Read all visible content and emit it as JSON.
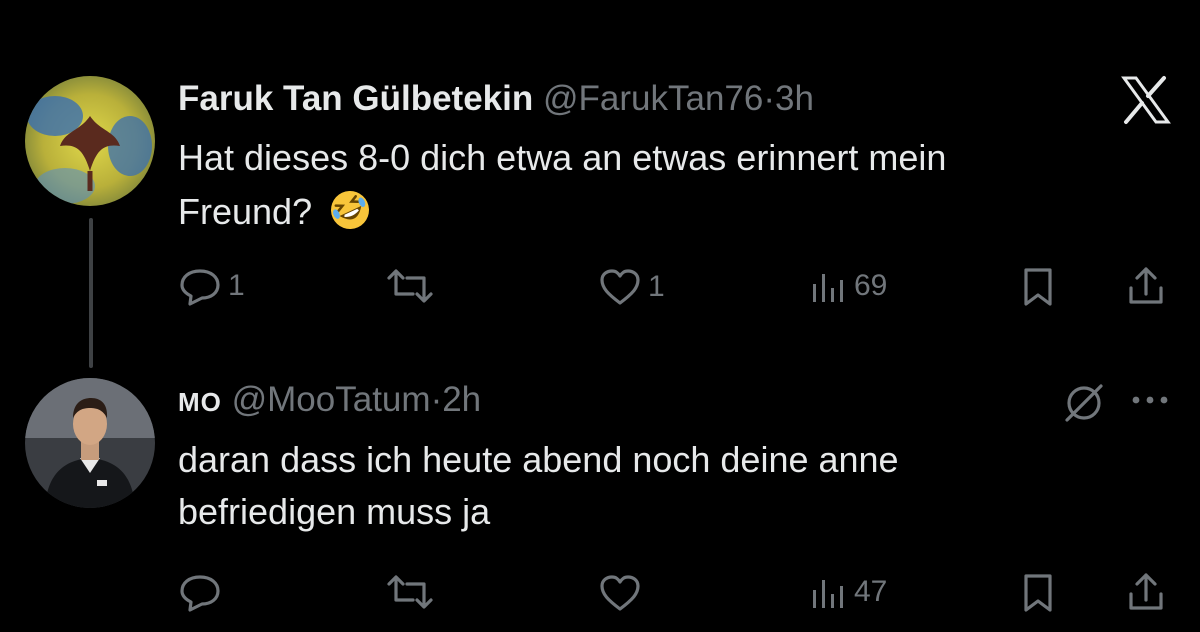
{
  "tweets": [
    {
      "name": "Faruk Tan Gülbetekin",
      "handle": "@FarukTan76",
      "separator": "·",
      "time": "3h",
      "text_line1": "Hat dieses 8-0 dich etwa an etwas erinnert mein",
      "text_line2": "Freund?",
      "emoji": "rolling-on-floor-laughing",
      "replies": "1",
      "likes": "1",
      "views": "69"
    },
    {
      "name": "MO",
      "handle": "@MooTatum",
      "separator": "·",
      "time": "2h",
      "text_line1": "daran dass ich heute abend noch deine anne",
      "text_line2": "befriedigen muss ja",
      "views": "47"
    }
  ],
  "icons": {
    "brand": "x-logo-icon",
    "grok": "grok-icon",
    "more": "more-icon"
  },
  "colors": {
    "background": "#000000",
    "text": "#e7e9ea",
    "secondary": "#71767b"
  }
}
